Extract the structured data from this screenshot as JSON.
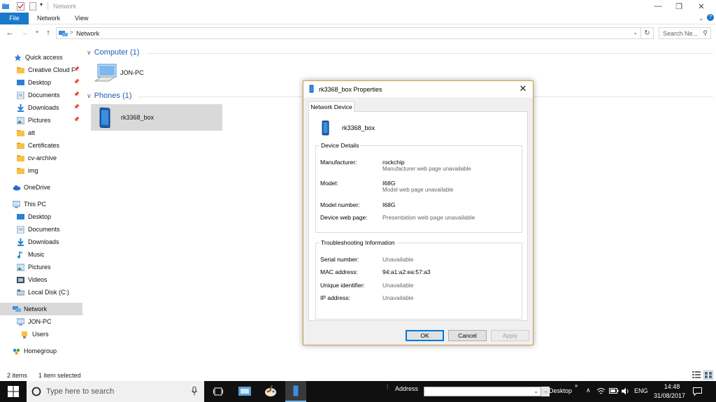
{
  "window": {
    "title": "Network",
    "controls": {
      "minimize": "—",
      "maximize": "❐",
      "close": "✕"
    }
  },
  "ribbon": {
    "tabs": [
      "File",
      "Network",
      "View"
    ]
  },
  "address": {
    "crumb_sep": ">",
    "crumb": "Network",
    "search_placeholder": "Search Ne..."
  },
  "nav": {
    "quick_access": "Quick access",
    "quick_items": [
      "Creative Cloud F",
      "Desktop",
      "Documents",
      "Downloads",
      "Pictures",
      "att",
      "Certificates",
      "cv-archive",
      "img"
    ],
    "onedrive": "OneDrive",
    "this_pc": "This PC",
    "pc_items": [
      "Desktop",
      "Documents",
      "Downloads",
      "Music",
      "Pictures",
      "Videos",
      "Local Disk (C:)"
    ],
    "network": "Network",
    "network_items": [
      "JON-PC",
      "Users"
    ],
    "homegroup": "Homegroup"
  },
  "content": {
    "groups": [
      {
        "header": "Computer (1)",
        "items": [
          "JON-PC"
        ]
      },
      {
        "header": "Phones (1)",
        "items": [
          "rk3368_box"
        ]
      }
    ]
  },
  "status": {
    "count": "2 items",
    "selected": "1 item selected"
  },
  "taskbar": {
    "search_placeholder": "Type here to search",
    "address_label": "Address",
    "desktop_label": "Desktop",
    "lang": "ENG",
    "time": "14:48",
    "date": "31/08/2017"
  },
  "dialog": {
    "title": "rk3368_box Properties",
    "tab": "Network Device",
    "device_name": "rk3368_box",
    "details_legend": "Device Details",
    "details": [
      {
        "label": "Manufacturer:",
        "value": "rockchip",
        "sub": "Manufacturer web page unavailable"
      },
      {
        "label": "Model:",
        "value": "I68G",
        "sub": "Model web page unavailable"
      },
      {
        "label": "Model number:",
        "value": "I68G",
        "sub": ""
      },
      {
        "label": "Device web page:",
        "value": "Presentation web page unavailable",
        "sub": ""
      }
    ],
    "trouble_legend": "Troubleshooting Information",
    "trouble": [
      {
        "label": "Serial number:",
        "value": "Unavailable"
      },
      {
        "label": "MAC address:",
        "value": "94:a1:a2:ea:57:a3"
      },
      {
        "label": "Unique identifier:",
        "value": "Unavailable"
      },
      {
        "label": "IP address:",
        "value": "Unavailable"
      }
    ],
    "buttons": {
      "ok": "OK",
      "cancel": "Cancel",
      "apply": "Apply"
    }
  },
  "colors": {
    "accent": "#1979ca",
    "link_header": "#1e5db3",
    "selection": "#d9d9d9",
    "dialog_border": "#c9a24a",
    "taskbar": "#101010"
  }
}
